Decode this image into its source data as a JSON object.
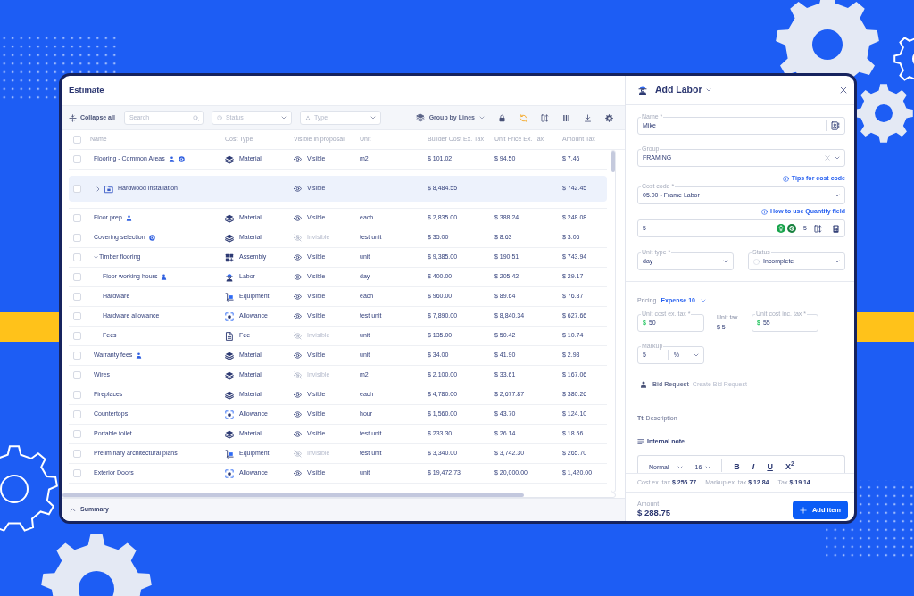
{
  "window": {
    "title": "Estimate"
  },
  "toolbar": {
    "collapse_all": "Collapse all",
    "search": {
      "placeholder": "Search"
    },
    "status_filter": {
      "placeholder": "Status"
    },
    "type_filter": {
      "placeholder": "Type"
    },
    "group_by": "Group by Lines"
  },
  "table": {
    "header_checkbox": {
      "checked": false
    },
    "columns": [
      "Name",
      "Cost Type",
      "Visible in proposal",
      "Unit",
      "Builder Cost Ex. Tax",
      "Unit Price Ex. Tax",
      "Amount Tax"
    ],
    "rows": [
      {
        "kind": "item",
        "checked": false,
        "name": "Flooring - Common Areas",
        "bid_request": true,
        "dollar_badge": true,
        "cost_type": {
          "kind": "material",
          "label": "Material"
        },
        "visible": true,
        "visibility": "Visible",
        "unit": "m2",
        "builder_cost": "$ 101.02",
        "unit_price": "$ 94.50",
        "amount_tax": "$ 7.46"
      },
      {
        "kind": "group",
        "checked": false,
        "expanded": false,
        "name": "Hardwood installation",
        "bid_request": false,
        "dollar_badge": false,
        "visible": true,
        "visibility": "Visible",
        "builder_cost": "$ 8,484.55",
        "amount_tax": "$ 742.45"
      },
      {
        "kind": "item",
        "checked": false,
        "name": "Floor prep",
        "bid_request": true,
        "dollar_badge": false,
        "cost_type": {
          "kind": "material",
          "label": "Material"
        },
        "visible": true,
        "visibility": "Visible",
        "unit": "each",
        "builder_cost": "$ 2,835.00",
        "unit_price": "$ 388.24",
        "amount_tax": "$ 248.08"
      },
      {
        "kind": "item",
        "checked": false,
        "name": "Covering selection",
        "bid_request": false,
        "dollar_badge": true,
        "cost_type": {
          "kind": "material",
          "label": "Material"
        },
        "visible": false,
        "visibility": "Invisible",
        "unit": "test unit",
        "builder_cost": "$ 35.00",
        "unit_price": "$ 8.63",
        "amount_tax": "$ 3.06"
      },
      {
        "kind": "assembly",
        "checked": false,
        "expanded": true,
        "name": "Timber flooring",
        "bid_request": false,
        "dollar_badge": false,
        "cost_type": {
          "kind": "assembly",
          "label": "Assembly"
        },
        "visible": true,
        "visibility": "Visible",
        "unit": "unit",
        "builder_cost": "$ 9,385.00",
        "unit_price": "$ 190.51",
        "amount_tax": "$ 743.94",
        "children": [
          {
            "kind": "item",
            "checked": false,
            "name": "Floor working hours",
            "bid_request": true,
            "dollar_badge": false,
            "cost_type": {
              "kind": "labor",
              "label": "Labor"
            },
            "visible": true,
            "visibility": "Visible",
            "unit": "day",
            "builder_cost": "$ 400.00",
            "unit_price": "$ 205.42",
            "amount_tax": "$ 29.17"
          },
          {
            "kind": "item",
            "checked": false,
            "name": "Hardware",
            "bid_request": false,
            "dollar_badge": false,
            "cost_type": {
              "kind": "equipment",
              "label": "Equipment"
            },
            "visible": true,
            "visibility": "Visible",
            "unit": "each",
            "builder_cost": "$ 960.00",
            "unit_price": "$ 89.64",
            "amount_tax": "$ 76.37"
          },
          {
            "kind": "item",
            "checked": false,
            "name": "Hardware allowance",
            "bid_request": false,
            "dollar_badge": false,
            "cost_type": {
              "kind": "allowance",
              "label": "Allowance"
            },
            "visible": true,
            "visibility": "Visible",
            "unit": "test unit",
            "builder_cost": "$ 7,890.00",
            "unit_price": "$ 8,840.34",
            "amount_tax": "$ 627.66"
          },
          {
            "kind": "item",
            "checked": false,
            "name": "Fees",
            "bid_request": false,
            "dollar_badge": false,
            "cost_type": {
              "kind": "fee",
              "label": "Fee"
            },
            "visible": false,
            "visibility": "Invisible",
            "unit": "unit",
            "builder_cost": "$ 135.00",
            "unit_price": "$ 50.42",
            "amount_tax": "$ 10.74"
          }
        ]
      },
      {
        "kind": "item",
        "checked": false,
        "name": "Warranty fees",
        "bid_request": true,
        "dollar_badge": false,
        "cost_type": {
          "kind": "material",
          "label": "Material"
        },
        "visible": true,
        "visibility": "Visible",
        "unit": "unit",
        "builder_cost": "$ 34.00",
        "unit_price": "$ 41.90",
        "amount_tax": "$ 2.98"
      },
      {
        "kind": "item",
        "checked": false,
        "name": "Wires",
        "bid_request": false,
        "dollar_badge": false,
        "cost_type": {
          "kind": "material",
          "label": "Material"
        },
        "visible": false,
        "visibility": "Invisible",
        "unit": "m2",
        "builder_cost": "$ 2,100.00",
        "unit_price": "$ 33.61",
        "amount_tax": "$ 167.06"
      },
      {
        "kind": "item",
        "checked": false,
        "name": "Fireplaces",
        "bid_request": false,
        "dollar_badge": false,
        "cost_type": {
          "kind": "material",
          "label": "Material"
        },
        "visible": true,
        "visibility": "Visible",
        "unit": "each",
        "builder_cost": "$ 4,780.00",
        "unit_price": "$ 2,677.87",
        "amount_tax": "$ 380.26"
      },
      {
        "kind": "item",
        "checked": false,
        "name": "Countertops",
        "bid_request": false,
        "dollar_badge": false,
        "cost_type": {
          "kind": "allowance",
          "label": "Allowance"
        },
        "visible": true,
        "visibility": "Visible",
        "unit": "hour",
        "builder_cost": "$ 1,560.00",
        "unit_price": "$ 43.70",
        "amount_tax": "$ 124.10"
      },
      {
        "kind": "item",
        "checked": false,
        "name": "Portable toilet",
        "bid_request": false,
        "dollar_badge": false,
        "cost_type": {
          "kind": "material",
          "label": "Material"
        },
        "visible": true,
        "visibility": "Visible",
        "unit": "test unit",
        "builder_cost": "$ 233.30",
        "unit_price": "$ 26.14",
        "amount_tax": "$ 18.56"
      },
      {
        "kind": "item",
        "checked": false,
        "name": "Preliminary architectural plans",
        "bid_request": false,
        "dollar_badge": false,
        "cost_type": {
          "kind": "equipment",
          "label": "Equipment"
        },
        "visible": false,
        "visibility": "Invisible",
        "unit": "test unit",
        "builder_cost": "$ 3,340.00",
        "unit_price": "$ 3,742.30",
        "amount_tax": "$ 265.70"
      },
      {
        "kind": "item",
        "checked": false,
        "name": "Exterior Doors",
        "bid_request": false,
        "dollar_badge": false,
        "cost_type": {
          "kind": "allowance",
          "label": "Allowance"
        },
        "visible": true,
        "visibility": "Visible",
        "unit": "unit",
        "builder_cost": "$ 19,472.73",
        "unit_price": "$ 20,000.00",
        "amount_tax": "$ 1,420.00"
      }
    ]
  },
  "summary": "Summary",
  "panel": {
    "title": "Add Labor",
    "name_field": {
      "label": "Name *",
      "value": "Mike"
    },
    "group_field": {
      "label": "Group",
      "value": "FRAMING"
    },
    "cost_code_tip": "Tips for cost code",
    "cost_code_field": {
      "label": "Cost code *",
      "value": "05.00 - Frame Labor"
    },
    "quantity_tip": "How to use Quantity field",
    "quantity_field": {
      "value": "5",
      "count": "5"
    },
    "unit_type_field": {
      "label": "Unit type *",
      "value": "day"
    },
    "status_field": {
      "label": "Status",
      "value": "Incomplete"
    },
    "pricing": {
      "label": "Pricing",
      "value": "Expense 10"
    },
    "unit_cost_field": {
      "label": "Unit cost ex. tax *",
      "currency": "$",
      "value": "50"
    },
    "unit_tax": {
      "label": "Unit tax",
      "value": "$ 5"
    },
    "unit_cost_inc_field": {
      "label": "Unit cost inc. tax *",
      "currency": "$",
      "value": "55"
    },
    "markup_field": {
      "label": "Markup",
      "value": "5",
      "unit": "%"
    },
    "bid_request": {
      "label": "Bid Request",
      "link": "Create Bid Request"
    },
    "description": {
      "icon": "Tt",
      "label": "Description"
    },
    "internal_note": "Internal note",
    "editor_toolbar": {
      "style": "Normal",
      "size": "16",
      "buttons": [
        {
          "kind": "bold",
          "label": "B"
        },
        {
          "kind": "italic",
          "label": "I"
        },
        {
          "kind": "underline",
          "label": "U"
        },
        {
          "kind": "superscript",
          "label": "X$^{2}$"
        }
      ]
    },
    "totals": [
      {
        "label": "Cost ex. tax",
        "value": "$ 256.77"
      },
      {
        "label": "Markup ex. tax",
        "value": "$ 12.84"
      },
      {
        "label": "Tax",
        "value": "$ 19.14"
      }
    ],
    "amount": {
      "label": "Amount",
      "value": "$ 288.75"
    },
    "submit": "Add item"
  }
}
